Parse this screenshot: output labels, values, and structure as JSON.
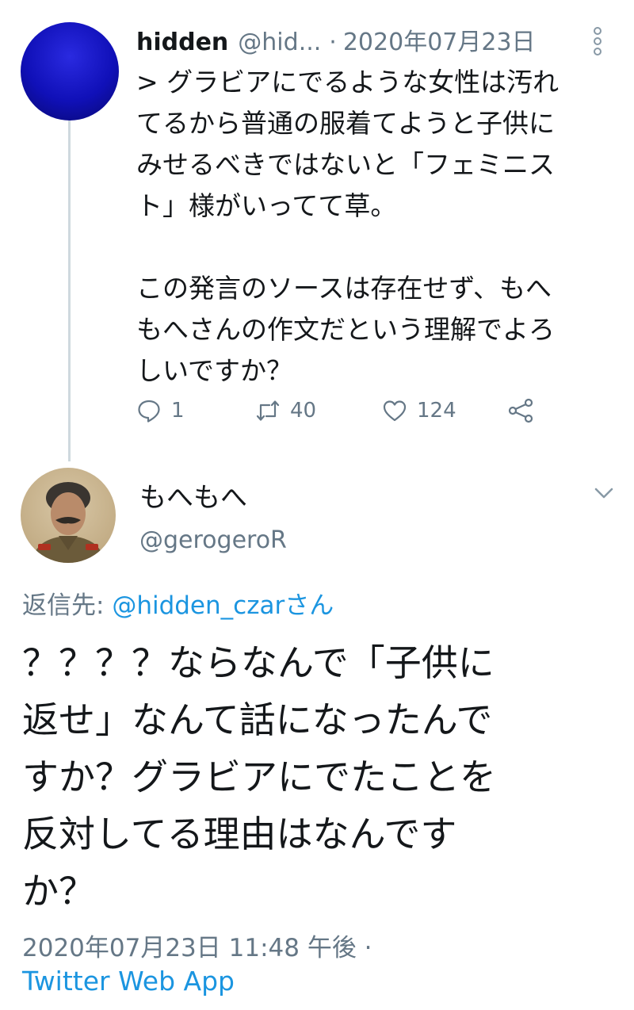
{
  "parent_tweet": {
    "display_name": "hidden",
    "handle": "@hid...",
    "separator": "·",
    "date": "2020年07月23日",
    "text": "> グラビアにでるような女性は汚れ\nてるから普通の服着てようと子供に\nみせるべきではないと「フェミニス\nト」様がいってて草。\n\nこの発言のソースは存在せず、もへ\nもへさんの作文だという理解でよろ\nしいですか？",
    "reply_count": "1",
    "retweet_count": "40",
    "like_count": "124",
    "icons": [
      "more-vertical-icon",
      "reply-icon",
      "retweet-icon",
      "heart-icon",
      "share-icon"
    ]
  },
  "main_tweet": {
    "display_name": "もへもへ",
    "handle": "@gerogeroR",
    "reply_prefix": "返信先: ",
    "reply_mention": "@hidden_czar",
    "reply_suffix": "さん",
    "text": "？？？？ならなんで「子供に\n返せ」なんて話になったんで\nすか？グラビアにでたことを\n反対してる理由はなんです\nか？",
    "timestamp": "2020年07月23日 11:48 午後 ·",
    "source": "Twitter Web App",
    "icons": [
      "chevron-down-icon"
    ]
  },
  "colors": {
    "text": "#14171a",
    "secondary": "#657786",
    "link": "#1b95e0",
    "thread_line": "#cfd9de"
  }
}
